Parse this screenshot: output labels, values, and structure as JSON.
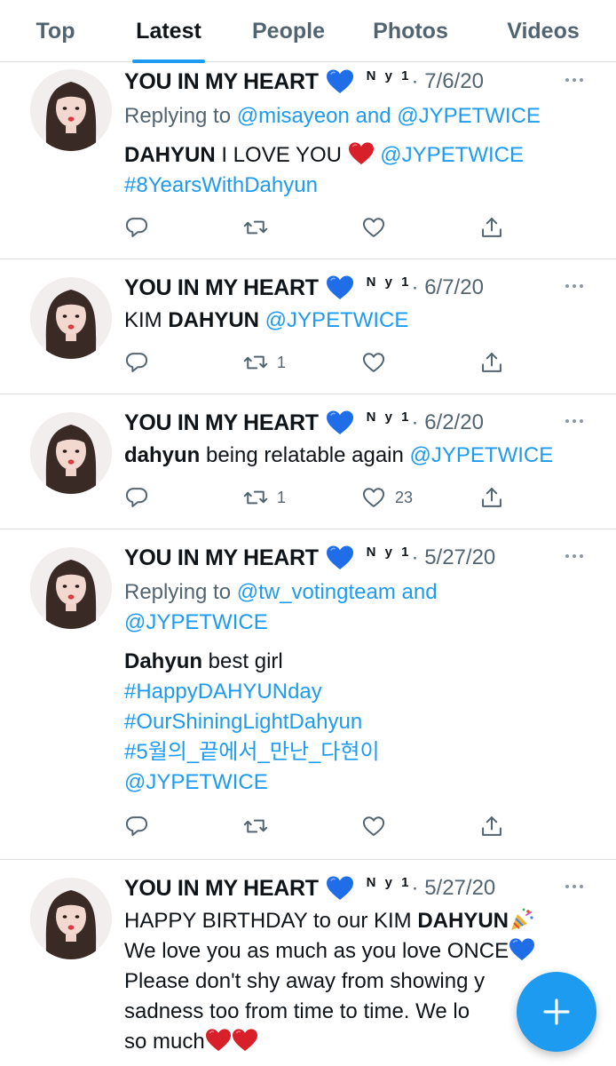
{
  "tabs": [
    {
      "label": "Top",
      "active": false
    },
    {
      "label": "Latest",
      "active": true
    },
    {
      "label": "People",
      "active": false
    },
    {
      "label": "Photos",
      "active": false
    },
    {
      "label": "Videos",
      "active": false
    }
  ],
  "author": {
    "display_name": "YOU IN MY HEART",
    "badge": "N y 1"
  },
  "tweets": [
    {
      "date": "· 7/6/20",
      "replying_prefix": "Replying to ",
      "replying_to": "@misayeon and @JYPETWICE",
      "text_bold": "DAHYUN",
      "text": " I LOVE YOU ",
      "mention": "@JYPETWICE",
      "hashtag": "#8YearsWithDahyun",
      "retweets": "",
      "likes": ""
    },
    {
      "date": "· 6/7/20",
      "text_prefix": "KIM ",
      "text_bold": "DAHYUN",
      "mention": " @JYPETWICE",
      "retweets": "1",
      "likes": ""
    },
    {
      "date": "· 6/2/20",
      "text_bold": "dahyun",
      "text": " being relatable again ",
      "mention": "@JYPETWICE",
      "retweets": "1",
      "likes": "23"
    },
    {
      "date": "· 5/27/20",
      "replying_prefix": "Replying to ",
      "replying_line1": "@tw_votingteam and",
      "replying_line2": "@JYPETWICE",
      "text_bold": "Dahyun",
      "text": " best girl",
      "hashtags": [
        "#HappyDAHYUNday",
        "#OurShiningLightDahyun",
        "#5월의_끝에서_만난_다현이"
      ],
      "mention": "@JYPETWICE",
      "retweets": "",
      "likes": ""
    },
    {
      "date": "· 5/27/20",
      "line1_prefix": "HAPPY BIRTHDAY to our KIM ",
      "line1_bold": "DAHYUN",
      "line2": "We love you as much as you love ONCE",
      "line3": "Please don't shy away from showing y",
      "line4": "sadness too from time to time. We lo",
      "line5": "so much"
    }
  ],
  "fab": {
    "icon": "plus-icon",
    "label": "Compose"
  },
  "colors": {
    "accent": "#1d9bf0",
    "muted": "#536471",
    "text": "#0f1419",
    "heart_red": "#d8202a",
    "heart_blue": "#1f6ee8"
  }
}
